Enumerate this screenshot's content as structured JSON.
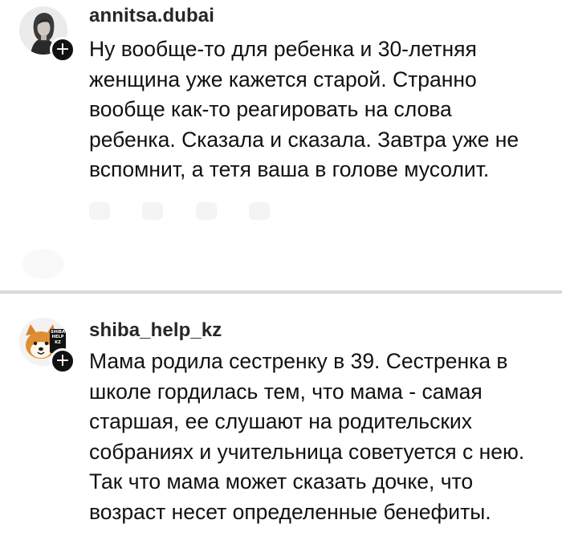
{
  "comments": [
    {
      "username": "annitsa.dubai",
      "avatar_icon": "woman-portrait-avatar",
      "follow_icon": "plus-icon",
      "follow_symbol": "+",
      "lines": [
        "Ну вообще-то для ребенка и 30-летняя",
        "женщина уже кажется старой. Странно",
        "вообще как-то реагировать на слова",
        "ребенка. Сказала и сказала. Завтра уже не",
        "вспомнит, а тетя ваша в голове мусолит."
      ]
    },
    {
      "username": "shiba_help_kz",
      "avatar_icon": "shiba-dog-avatar",
      "avatar_badge_text": "SHIBA HELP KZ",
      "follow_icon": "plus-icon",
      "follow_symbol": "+",
      "lines": [
        "Мама родила сестренку в 39. Сестренка в",
        "школе гордилась тем, что мама - самая",
        "старшая, ее слушают на родительских",
        "собраниях и учительница советуется с нею.",
        "Так что мама может сказать дочке, что",
        "возраст несет определенные бенефиты."
      ]
    }
  ]
}
